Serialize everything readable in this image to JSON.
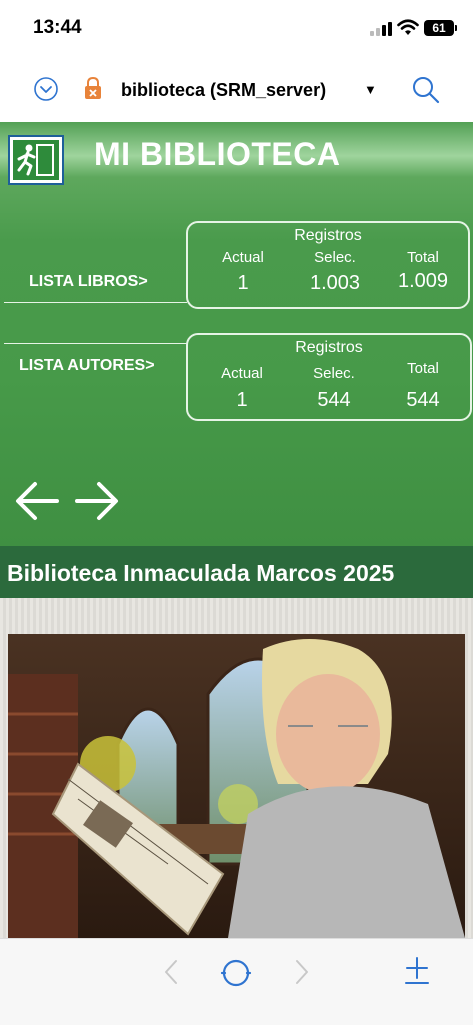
{
  "status_bar": {
    "time": "13:44",
    "battery": "61"
  },
  "nav_bar": {
    "title": "biblioteca (SRM_server)"
  },
  "app": {
    "title": "MI BIBLIOTECA"
  },
  "books": {
    "label": "LISTA LIBROS>",
    "registros_label": "Registros",
    "actual_label": "Actual",
    "selec_label": "Selec.",
    "total_label": "Total",
    "actual": "1",
    "selec": "1.003",
    "total": "1.009"
  },
  "authors": {
    "label": "LISTA AUTORES>",
    "registros_label": "Registros",
    "actual_label": "Actual",
    "selec_label": "Selec.",
    "total_label": "Total",
    "actual": "1",
    "selec": "544",
    "total": "544"
  },
  "banner": {
    "text": "Biblioteca Inmaculada Marcos 2025"
  },
  "icons": {
    "nav": [
      "chevron-down-icon",
      "lock-icon",
      "dropdown-arrow-icon",
      "search-icon"
    ],
    "app": [
      "exit-icon",
      "arrow-left-icon",
      "arrow-right-icon"
    ],
    "bottom": [
      "back-icon",
      "home-icon",
      "forward-icon",
      "add-icon"
    ]
  },
  "colors": {
    "header_green": "#479a49",
    "banner_green": "#2b6a3c",
    "ios_blue": "#2f74d0"
  }
}
